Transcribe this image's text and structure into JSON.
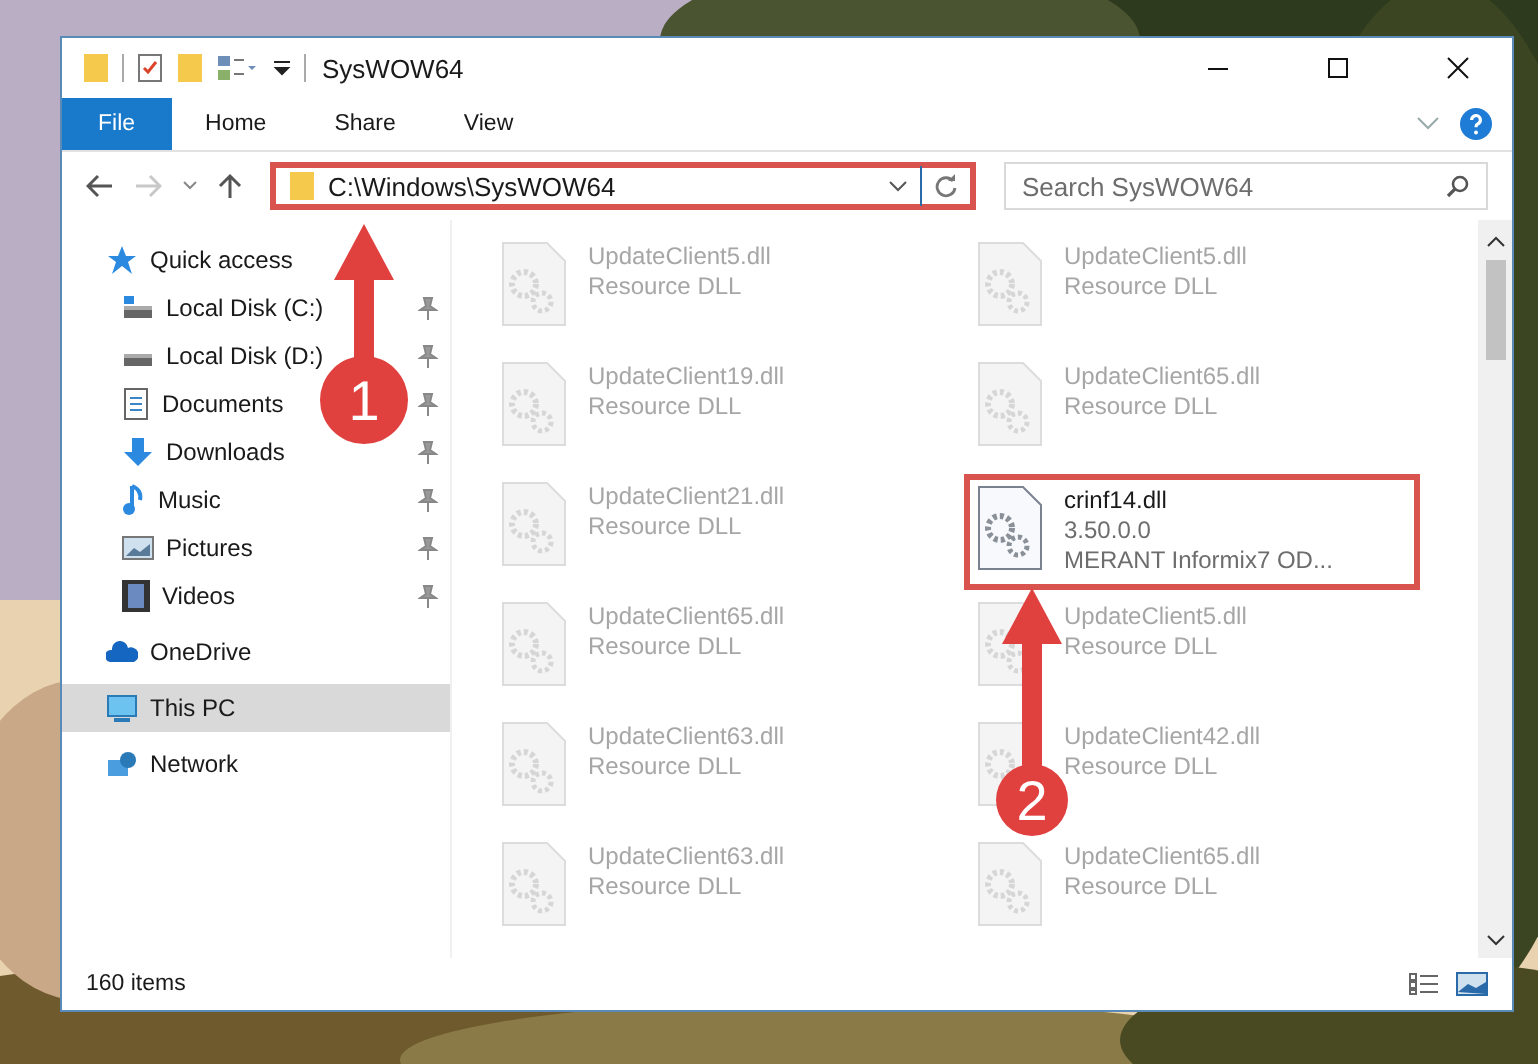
{
  "window": {
    "title": "SysWOW64"
  },
  "ribbon_tabs": [
    {
      "label": "File",
      "kind": "file"
    },
    {
      "label": "Home",
      "kind": "tab"
    },
    {
      "label": "Share",
      "kind": "tab"
    },
    {
      "label": "View",
      "kind": "tab"
    }
  ],
  "address": {
    "path": "C:\\Windows\\SysWOW64",
    "highlighted": true
  },
  "search": {
    "placeholder": "Search SysWOW64"
  },
  "nav": [
    {
      "label": "Quick access",
      "kind": "star",
      "selected": false,
      "children": [
        {
          "label": "Local Disk (C:)",
          "kind": "disk",
          "pinned": true,
          "selected": false
        },
        {
          "label": "Local Disk (D:)",
          "kind": "disk",
          "pinned": true,
          "selected": false
        },
        {
          "label": "Documents",
          "kind": "document",
          "pinned": true,
          "selected": false
        },
        {
          "label": "Downloads",
          "kind": "download",
          "pinned": true,
          "selected": false
        },
        {
          "label": "Music",
          "kind": "music",
          "pinned": true,
          "selected": false
        },
        {
          "label": "Pictures",
          "kind": "pictures",
          "pinned": true,
          "selected": false
        },
        {
          "label": "Videos",
          "kind": "videos",
          "pinned": true,
          "selected": false
        }
      ]
    },
    {
      "label": "OneDrive",
      "kind": "cloud",
      "selected": false
    },
    {
      "label": "This PC",
      "kind": "pc",
      "selected": true
    },
    {
      "label": "Network",
      "kind": "network",
      "selected": false
    }
  ],
  "files": [
    {
      "name": "UpdateClient5.dll",
      "lines": [
        "Resource DLL"
      ],
      "blurred": true,
      "highlighted": false
    },
    {
      "name": "UpdateClient5.dll",
      "lines": [
        "Resource DLL"
      ],
      "blurred": true,
      "highlighted": false
    },
    {
      "name": "UpdateClient19.dll",
      "lines": [
        "Resource DLL"
      ],
      "blurred": true,
      "highlighted": false
    },
    {
      "name": "UpdateClient65.dll",
      "lines": [
        "Resource DLL"
      ],
      "blurred": true,
      "highlighted": false
    },
    {
      "name": "UpdateClient21.dll",
      "lines": [
        "Resource DLL"
      ],
      "blurred": true,
      "highlighted": false
    },
    {
      "name": "crinf14.dll",
      "lines": [
        "3.50.0.0",
        "MERANT Informix7 OD..."
      ],
      "blurred": false,
      "highlighted": true
    },
    {
      "name": "UpdateClient65.dll",
      "lines": [
        "Resource DLL"
      ],
      "blurred": true,
      "highlighted": false
    },
    {
      "name": "UpdateClient5.dll",
      "lines": [
        "Resource DLL"
      ],
      "blurred": true,
      "highlighted": false
    },
    {
      "name": "UpdateClient63.dll",
      "lines": [
        "Resource DLL"
      ],
      "blurred": true,
      "highlighted": false
    },
    {
      "name": "UpdateClient42.dll",
      "lines": [
        "Resource DLL"
      ],
      "blurred": true,
      "highlighted": false
    },
    {
      "name": "UpdateClient63.dll",
      "lines": [
        "Resource DLL"
      ],
      "blurred": true,
      "highlighted": false
    },
    {
      "name": "UpdateClient65.dll",
      "lines": [
        "Resource DLL"
      ],
      "blurred": true,
      "highlighted": false
    }
  ],
  "status_bar": {
    "count": "160 items"
  },
  "annotations": [
    {
      "number": "1"
    },
    {
      "number": "2"
    }
  ]
}
